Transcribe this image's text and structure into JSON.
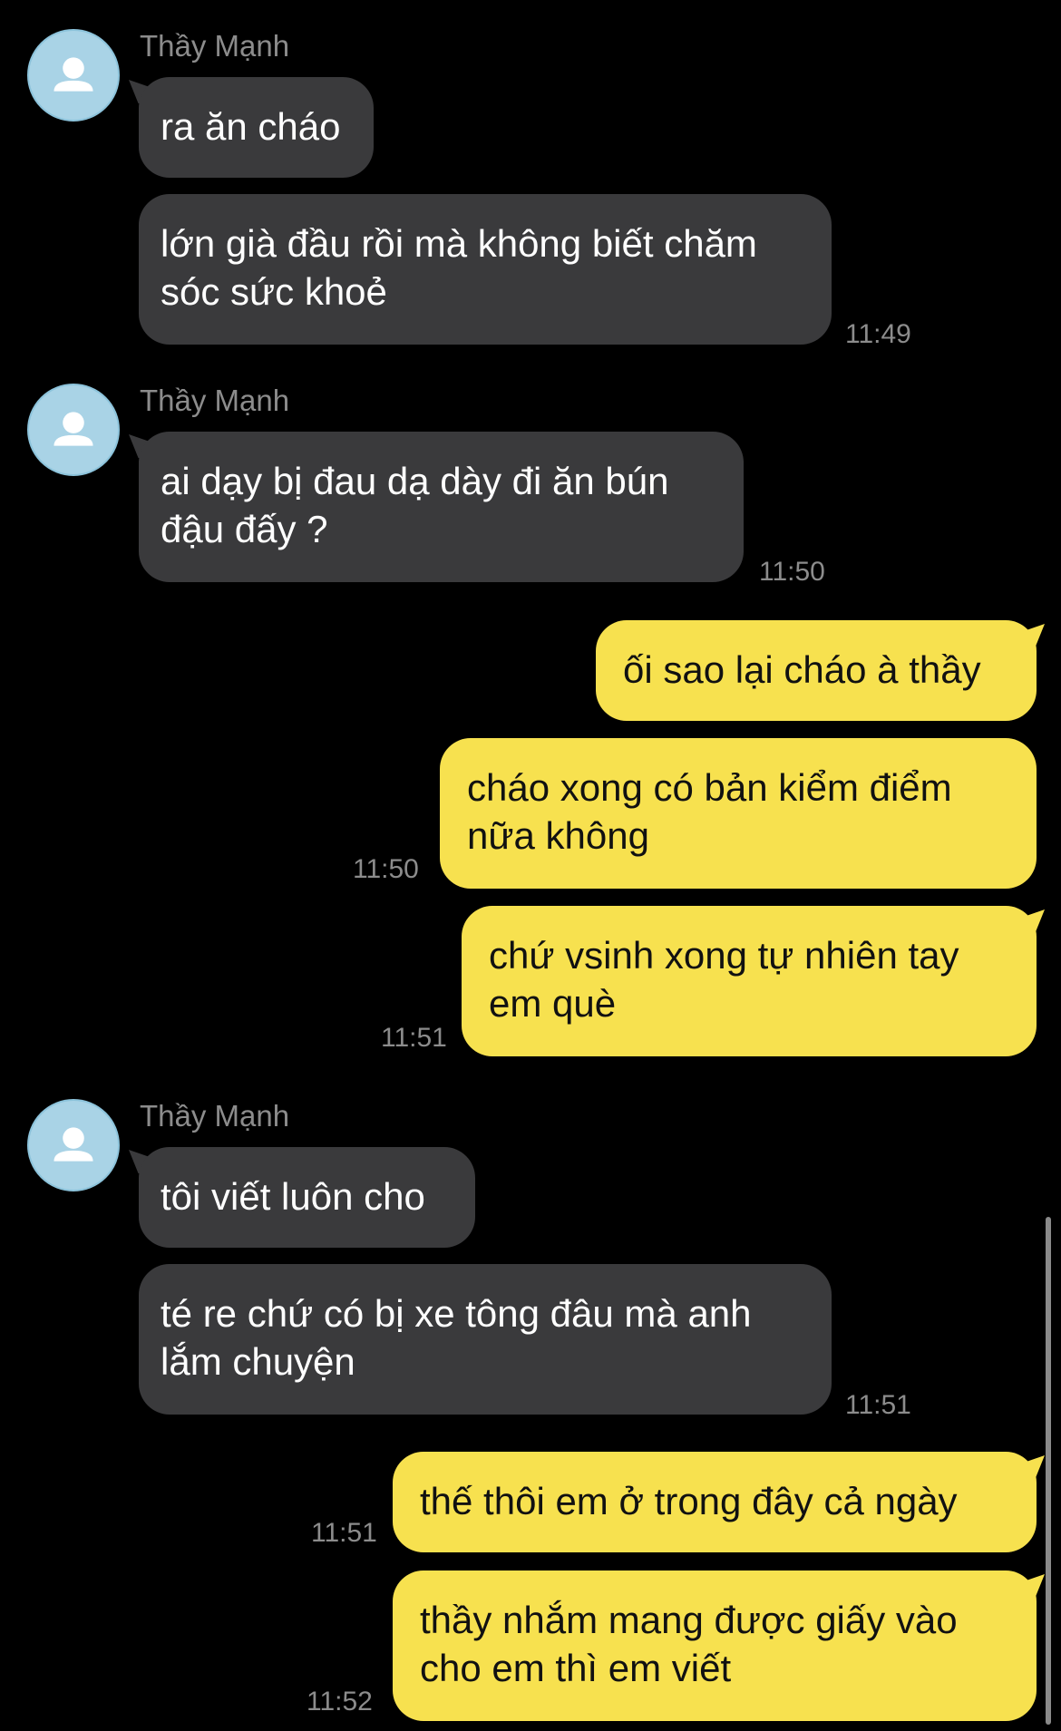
{
  "sender_name": "Thầy Mạnh",
  "colors": {
    "incoming_bubble": "#3a3a3c",
    "outgoing_bubble": "#f7e14f",
    "avatar": "#a9d3e6",
    "background": "#000000"
  },
  "icons": {
    "avatar": "person-silhouette-icon"
  },
  "messages": [
    {
      "from": "them",
      "text": "ra ăn cháo"
    },
    {
      "from": "them",
      "text": "lớn già đầu rồi mà không biết chăm\nsóc sức khoẻ",
      "time": "11:49"
    },
    {
      "from": "them",
      "text": "ai dạy bị đau dạ dày đi ăn bún\nđậu đấy ?",
      "time": "11:50"
    },
    {
      "from": "me",
      "text": "ối sao lại cháo à thầy"
    },
    {
      "from": "me",
      "text": "cháo xong có bản kiểm điểm\nnữa không",
      "time": "11:50"
    },
    {
      "from": "me",
      "text": "chứ vsinh xong tự nhiên tay\nem què",
      "time": "11:51"
    },
    {
      "from": "them",
      "text": "tôi viết luôn cho"
    },
    {
      "from": "them",
      "text": "té re chứ có bị xe tông đâu mà anh\nlắm chuyện",
      "time": "11:51"
    },
    {
      "from": "me",
      "text": "thế thôi em ở trong đây cả ngày",
      "time": "11:51"
    },
    {
      "from": "me",
      "text": "thầy nhắm mang được giấy vào\ncho em thì em viết",
      "time": "11:52"
    }
  ]
}
